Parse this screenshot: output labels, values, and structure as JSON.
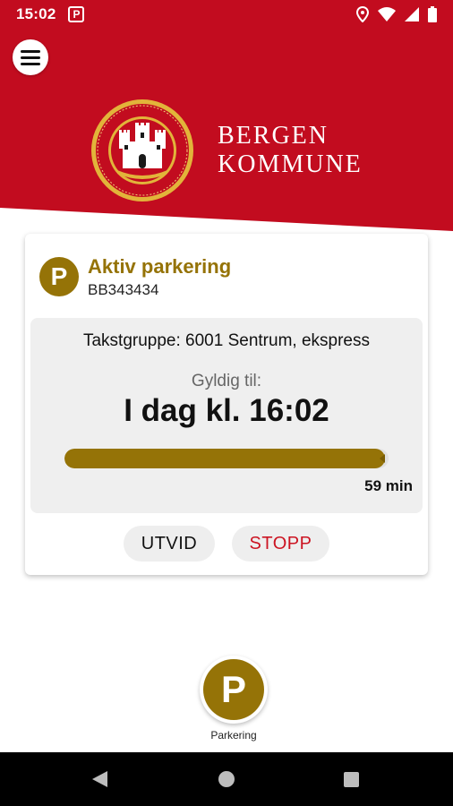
{
  "status_bar": {
    "time": "15:02",
    "parking_indicator": "P",
    "icons": [
      "location-icon",
      "wifi-icon",
      "signal-icon",
      "battery-icon"
    ]
  },
  "header": {
    "menu_icon": "hamburger-menu-icon",
    "logo": "bergen-crest",
    "brand_line1": "BERGEN",
    "brand_line2": "KOMMUNE",
    "brand_color": "#c20c1f"
  },
  "parking": {
    "badge": "P",
    "title": "Aktiv parkering",
    "plate": "BB343434",
    "tariff": "Takstgruppe: 6001 Sentrum, ekspress",
    "valid_label": "Gyldig til:",
    "valid_until": "I dag kl. 16:02",
    "progress_fraction": 0.99,
    "remaining": "59 min",
    "accent_color": "#957307"
  },
  "actions": {
    "extend_label": "UTVID",
    "stop_label": "STOPP",
    "stop_color": "#cc1422"
  },
  "bottom_nav": {
    "fab_letter": "P",
    "label": "Parkering"
  },
  "system_nav": [
    "back-icon",
    "home-icon",
    "recent-apps-icon"
  ]
}
